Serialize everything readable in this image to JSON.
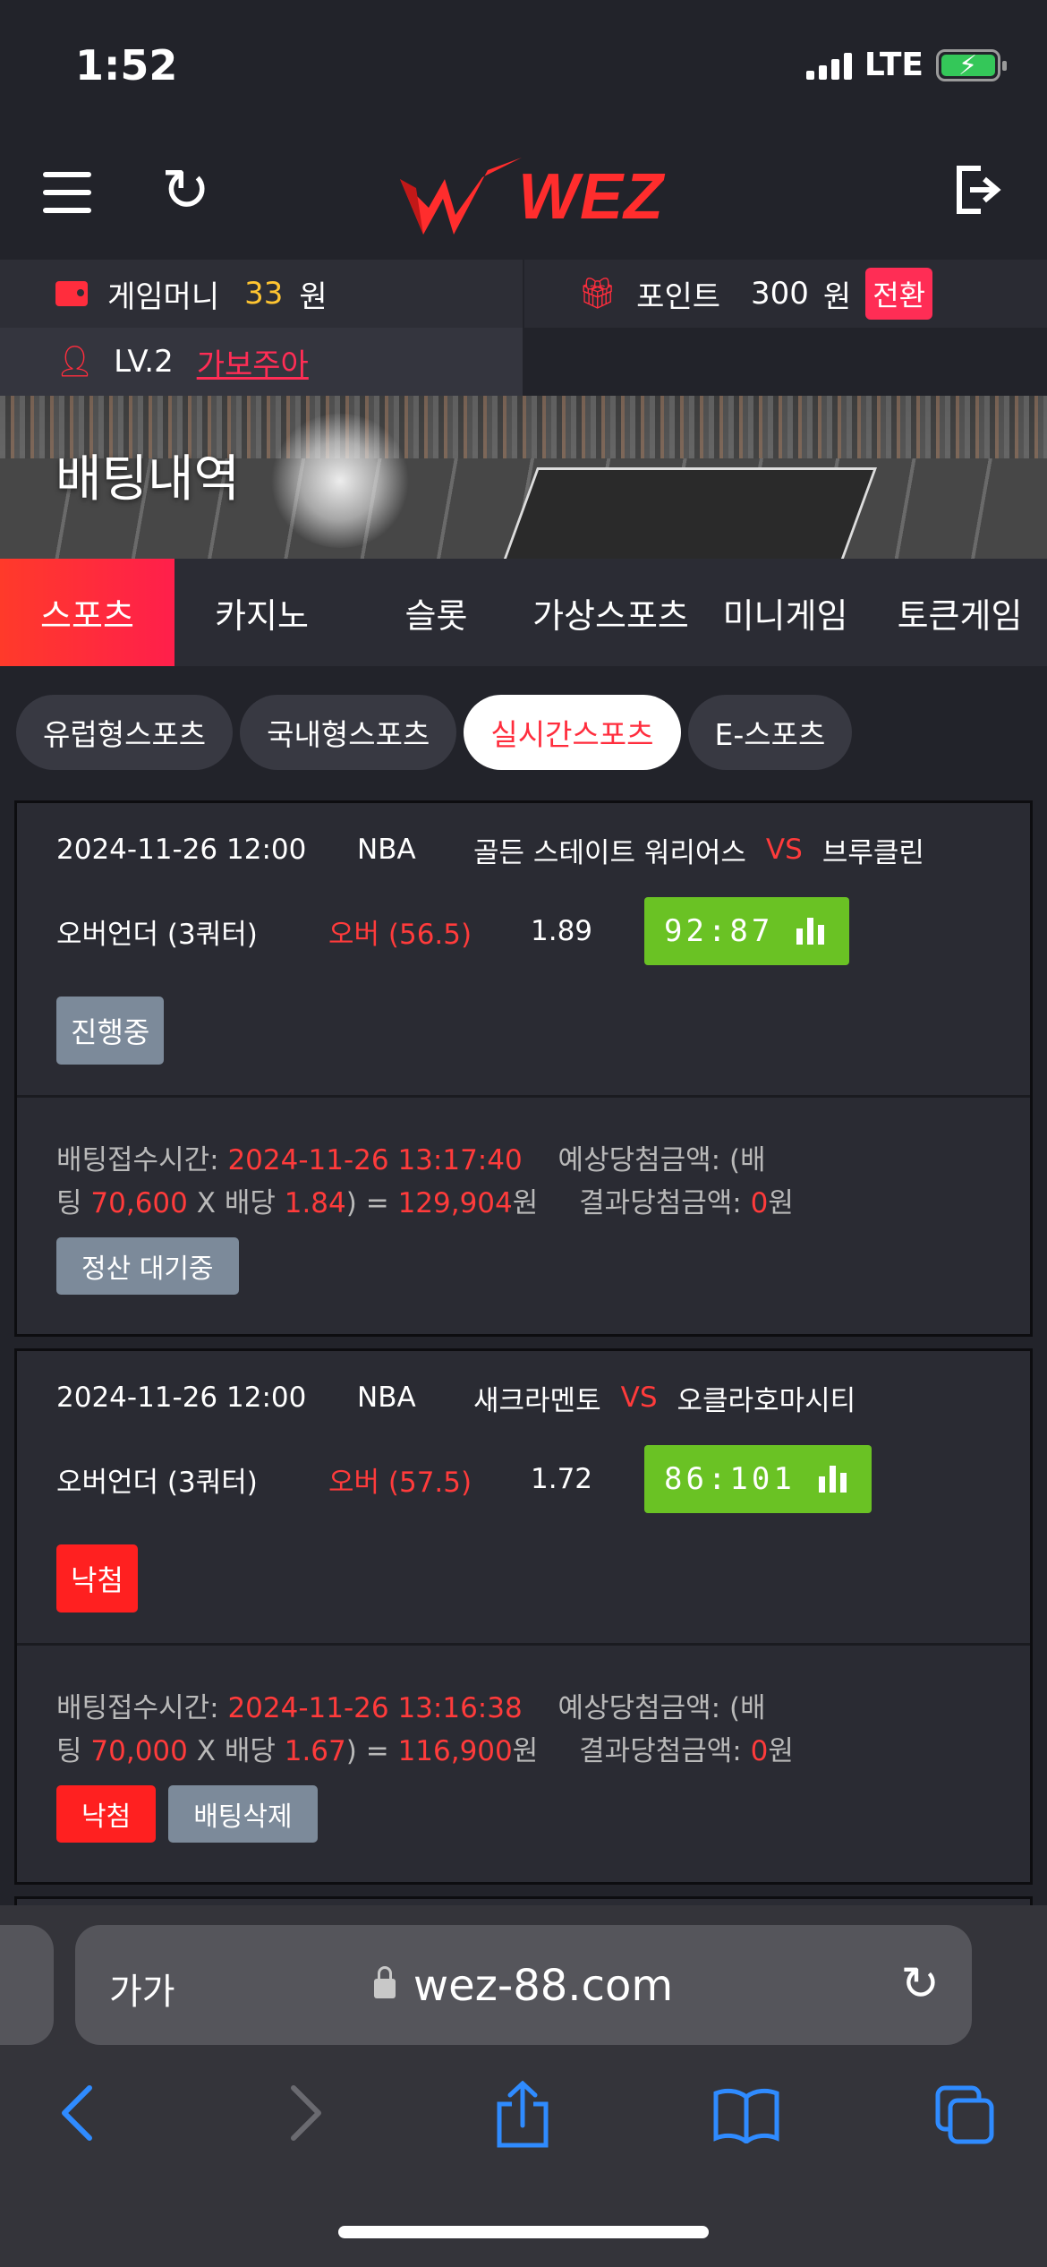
{
  "status_bar": {
    "time": "1:52",
    "network": "LTE"
  },
  "header": {
    "logo_text": "WEZ"
  },
  "user": {
    "money_label": "게임머니",
    "money_value": "33",
    "money_unit": "원",
    "point_label": "포인트",
    "point_value": "300",
    "point_unit": "원",
    "convert_label": "전환",
    "level": "LV.2",
    "nickname": "가보주아"
  },
  "banner": {
    "title": "배팅내역"
  },
  "main_tabs": [
    "스포츠",
    "카지노",
    "슬롯",
    "가상스포츠",
    "미니게임",
    "토큰게임"
  ],
  "sub_tabs": [
    "유럽형스포츠",
    "국내형스포츠",
    "실시간스포츠",
    "E-스포츠"
  ],
  "bets": [
    {
      "datetime": "2024-11-26 12:00",
      "league": "NBA",
      "home": "골든 스테이트 워리어스",
      "vs": "VS",
      "away": "브루클린",
      "market": "오버언더 (3쿼터)",
      "pick": "오버 (56.5)",
      "odds": "1.89",
      "score": "92:87",
      "status": "진행중",
      "time_label": "배팅접수시간:",
      "time_value": "2024-11-26 13:17:40",
      "expected_label": "예상당첨금액: (배",
      "line2_prefix": "팅",
      "stake": "70,600",
      "mult_label": "X 배당",
      "bet_odds": "1.84",
      "eq": ") =",
      "expected": "129,904",
      "won": "원",
      "result_label": "결과당첨금액:",
      "result_value": "0",
      "result_unit": "원",
      "buttons": [
        "정산 대기중"
      ]
    },
    {
      "datetime": "2024-11-26 12:00",
      "league": "NBA",
      "home": "새크라멘토",
      "vs": "VS",
      "away": "오클라호마시티",
      "market": "오버언더 (3쿼터)",
      "pick": "오버 (57.5)",
      "odds": "1.72",
      "score": "86:101",
      "status": "낙첨",
      "time_label": "배팅접수시간:",
      "time_value": "2024-11-26 13:16:38",
      "expected_label": "예상당첨금액: (배",
      "line2_prefix": "팅",
      "stake": "70,000",
      "mult_label": "X 배당",
      "bet_odds": "1.67",
      "eq": ") =",
      "expected": "116,900",
      "won": "원",
      "result_label": "결과당첨금액:",
      "result_value": "0",
      "result_unit": "원",
      "buttons": [
        "낙첨",
        "배팅삭제"
      ]
    }
  ],
  "browser": {
    "aa_label": "가가",
    "url": "wez-88.com"
  },
  "colors": {
    "accent_red": "#ff2d3d",
    "score_green": "#6ac224",
    "link_blue": "#2f8bff"
  }
}
